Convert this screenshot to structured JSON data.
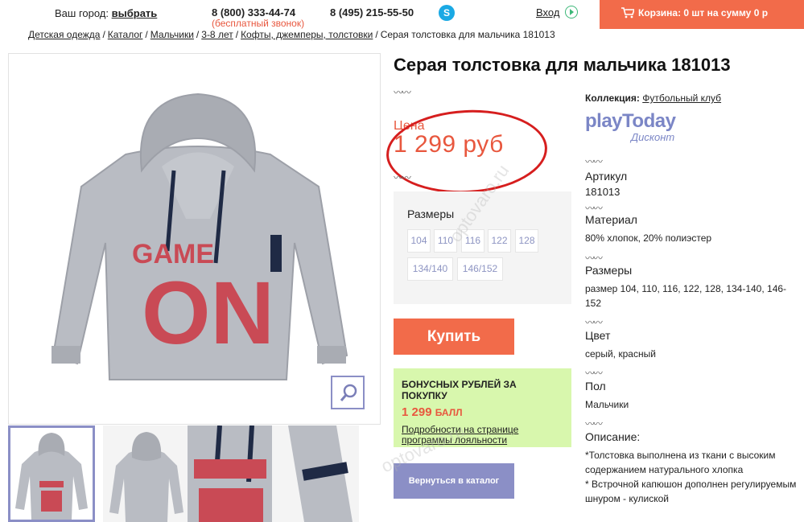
{
  "header": {
    "city_label": "Ваш город:",
    "city_link": "выбрать",
    "phone_free": "8 (800) 333-44-74",
    "phone_free_note": "(бесплатный звонок)",
    "phone_moscow": "8 (495) 215-55-50",
    "skype_icon": "skype-icon",
    "login_label": "Вход",
    "cart_label": "Корзина: 0 шт на сумму 0 р"
  },
  "breadcrumb": {
    "items": [
      "Детская одежда",
      "Каталог",
      "Мальчики",
      "3-8 лет",
      "Кофты, джемперы, толстовки"
    ],
    "current": "Серая толстовка для мальчика 181013"
  },
  "product": {
    "title": "Серая толстовка для мальчика 181013",
    "price_label": "Цена",
    "price_value": "1 299 руб",
    "sizes_title": "Размеры",
    "sizes": [
      "104",
      "110",
      "116",
      "122",
      "128",
      "134/140",
      "146/152"
    ],
    "buy_label": "Купить",
    "bonus_title": "БОНУСНЫХ РУБЛЕЙ ЗА ПОКУПКУ",
    "bonus_value": "1 299",
    "bonus_unit": "БАЛЛ",
    "bonus_link": "Подробности на странице программы лояльности",
    "back_label": "Вернуться в каталог",
    "print_top": "GAME",
    "print_bottom": "ON",
    "sleeve_tag": "GAME ON"
  },
  "details": {
    "collection_label": "Коллекция:",
    "collection_value": "Футбольный клуб",
    "brand_name": "playToday",
    "brand_sub": "Дисконт",
    "article_title": "Артикул",
    "article_value": "181013",
    "material_title": "Материал",
    "material_value": "80% хлопок, 20% полиэстер",
    "sizes_title": "Размеры",
    "sizes_value": "размер 104, 110, 116, 122, 128, 134-140, 146-152",
    "color_title": "Цвет",
    "color_value": "серый, красный",
    "gender_title": "Пол",
    "gender_value": "Мальчики",
    "desc_title": "Описание:",
    "desc_line1": "*Толстовка выполнена из ткани с высоким содержанием натурального хлопка",
    "desc_line2": "* Встрочной капюшон дополнен регулируемым шнуром - кулиской"
  },
  "watermark": "optovaro.ru",
  "colors": {
    "accent": "#f26b4a",
    "price": "#e8573e",
    "secondary": "#8b8fc6",
    "bonus_bg": "#d8f7ad",
    "brand": "#7b86c6",
    "circle": "#d61e1e"
  }
}
